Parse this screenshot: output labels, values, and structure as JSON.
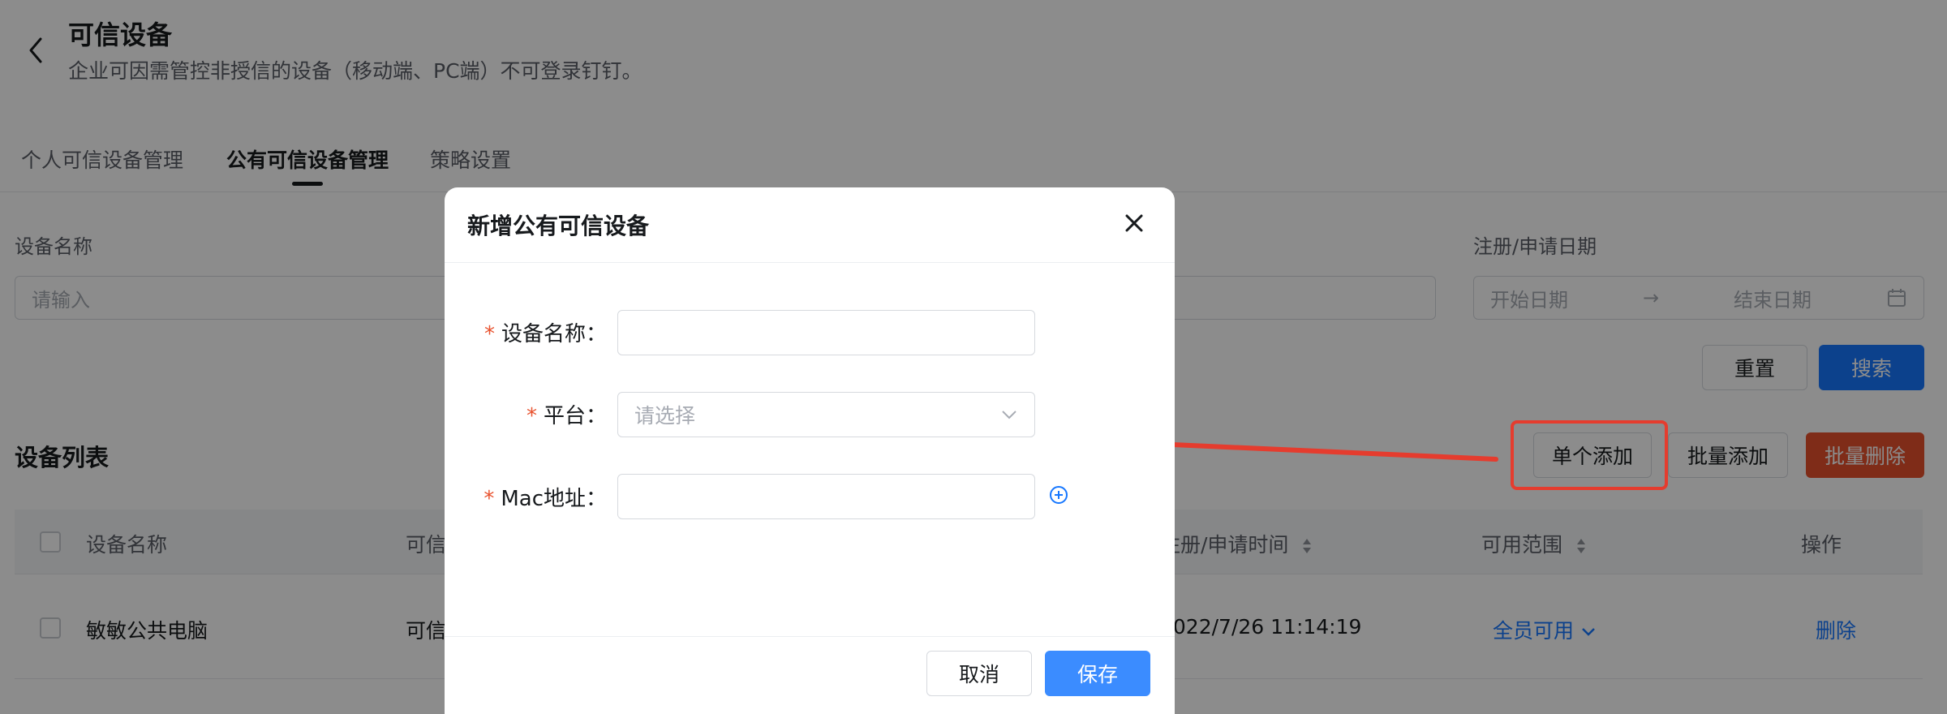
{
  "header": {
    "title": "可信设备",
    "subtitle": "企业可因需管控非授信的设备（移动端、PC端）不可登录钉钉。",
    "back_icon": "chevron-left-icon"
  },
  "tabs": [
    {
      "label": "个人可信设备管理",
      "active": false
    },
    {
      "label": "公有可信设备管理",
      "active": true
    },
    {
      "label": "策略设置",
      "active": false
    }
  ],
  "filters": {
    "device_name_label": "设备名称",
    "device_name_placeholder": "请输入",
    "date_label": "注册/申请日期",
    "start_date_placeholder": "开始日期",
    "date_separator": "→",
    "end_date_placeholder": "结束日期",
    "reset_label": "重置",
    "search_label": "搜索"
  },
  "list": {
    "title": "设备列表",
    "single_add_label": "单个添加",
    "batch_add_label": "批量添加",
    "batch_delete_label": "批量删除"
  },
  "table": {
    "columns": [
      "设备名称",
      "可信",
      "注册/申请时间",
      "可用范围",
      "操作"
    ],
    "rows": [
      {
        "name": "敏敏公共电脑",
        "status": "可信",
        "time": "2022/7/26 11:14:19",
        "scope": "全员可用",
        "action": "删除"
      }
    ]
  },
  "modal": {
    "title": "新增公有可信设备",
    "fields": {
      "device_name_label": "设备名称：",
      "platform_label": "平台：",
      "platform_placeholder": "请选择",
      "mac_label": "Mac地址："
    },
    "required_mark": "*",
    "cancel_label": "取消",
    "save_label": "保存"
  },
  "colors": {
    "primary": "#1677ff",
    "danger": "#e8512d",
    "annotation": "#e53c2e",
    "mask": "rgba(0,0,0,0.45)"
  }
}
